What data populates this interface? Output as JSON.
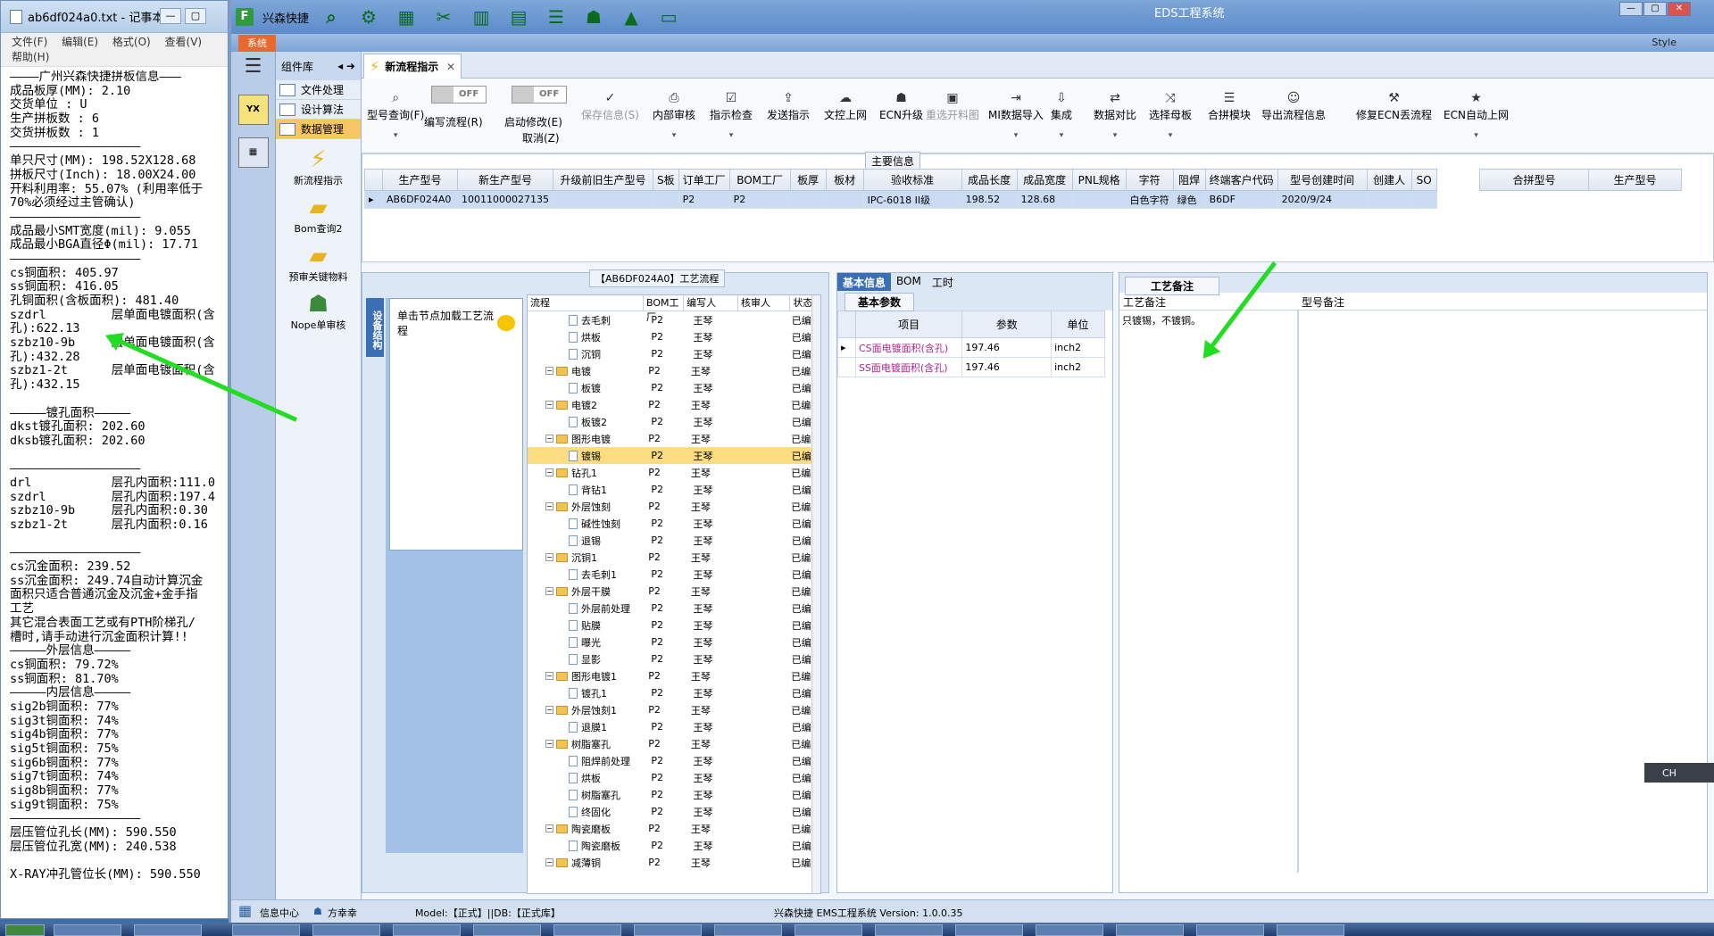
{
  "notepad": {
    "title": "ab6df024a0.txt - 记事本",
    "menu": [
      "文件(F)",
      "编辑(E)",
      "格式(O)",
      "查看(V)",
      "帮助(H)"
    ],
    "lines": [
      "————广州兴森快捷拼板信息———",
      "成品板厚(MM): 2.10",
      "交货单位 : U",
      "生产拼板数 : 6",
      "交货拼板数 : 1",
      "——————————————————",
      "单只尺寸(MM): 198.52X128.68",
      "拼板尺寸(Inch): 18.00X24.00",
      "开料利用率: 55.07% (利用率低于",
      "70%必须经过主管确认)",
      "——————————————————",
      "成品最小SMT宽度(mil): 9.055",
      "成品最小BGA直径Φ(mil): 17.71",
      "——————————————————",
      "cs铜面积: 405.97",
      "ss铜面积: 416.05",
      "孔铜面积(含板面积): 481.40",
      "szdrl         层单面电镀面积(含",
      "孔):622.13",
      "szbz10-9b     层单面电镀面积(含",
      "孔):432.28",
      "szbz1-2t      层单面电镀面积(含",
      "孔):432.15",
      "",
      "—————镀孔面积—————",
      "dkst镀孔面积: 202.60",
      "dksb镀孔面积: 202.60",
      "",
      "——————————————————",
      "drl           层孔内面积:111.0",
      "szdrl         层孔内面积:197.4",
      "szbz10-9b     层孔内面积:0.30",
      "szbz1-2t      层孔内面积:0.16",
      "",
      "——————————————————",
      "cs沉金面积: 239.52",
      "ss沉金面积: 249.74自动计算沉金",
      "面积只适合普通沉金及沉金+金手指",
      "工艺",
      "其它混合表面工艺或有PTH阶梯孔/",
      "槽时,请手动进行沉金面积计算!!",
      "—————外层信息—————",
      "cs铜面积: 79.72%",
      "ss铜面积: 81.70%",
      "—————内层信息—————",
      "sig2b铜面积: 77%",
      "sig3t铜面积: 74%",
      "sig4b铜面积: 77%",
      "sig5t铜面积: 75%",
      "sig6b铜面积: 77%",
      "sig7t铜面积: 74%",
      "sig8b铜面积: 77%",
      "sig9t铜面积: 75%",
      "——————————————————",
      "层压管位孔长(MM): 590.550",
      "层压管位孔宽(MM): 240.538",
      "",
      "X-RAY冲孔管位长(MM): 590.550"
    ]
  },
  "app": {
    "company": "兴森快捷",
    "title": "EDS工程系统",
    "sys_tab": "系统",
    "style_label": "Style",
    "component_lib": "组件库",
    "comp_items": [
      "文件处理",
      "设计算法",
      "数据管理"
    ],
    "comp_big": [
      "新流程指示",
      "Bom查询2",
      "预审关键物料",
      "Nope单审核"
    ],
    "tab_label": "新流程指示",
    "toolbar": {
      "model_query": "型号查询(F)",
      "toggle_off": "OFF",
      "edit_flow": "编写流程(R)",
      "start_modify": "启动修改(E)",
      "cancel": "取消(Z)",
      "save_info": "保存信息(S)",
      "items": [
        "内部审核",
        "指示检查",
        "发送指示",
        "文控上网",
        "ECN升级",
        "重选开料图",
        "MI数据导入",
        "集成",
        "数据对比",
        "选择母板",
        "合拼模块",
        "导出流程信息",
        "修复ECN丢流程",
        "ECN自动上网"
      ]
    },
    "main_info": {
      "title": "主要信息",
      "headers": [
        "生产型号",
        "新生产型号",
        "升级前旧生产型号",
        "S板",
        "订单工厂",
        "BOM工厂",
        "板厚",
        "板材",
        "验收标准",
        "成品长度",
        "成品宽度",
        "PNL规格",
        "字符",
        "阻焊",
        "终端客户代码",
        "型号创建时间",
        "创建人",
        "SO"
      ],
      "row": [
        "AB6DF024A0",
        "10011000027135",
        "",
        "",
        "P2",
        "P2",
        "",
        "",
        "IPC-6018 II级",
        "198.52",
        "128.68",
        "",
        "白色字符",
        "绿色",
        "B6DF",
        "2020/9/24",
        "",
        ""
      ],
      "side_headers": [
        "合拼型号",
        "生产型号"
      ]
    },
    "flow": {
      "title": "【AB6DF024A0】工艺流程",
      "vert_tab": "设备结构",
      "hint": "单击节点加载工艺流程",
      "headers": [
        "流程",
        "BOM工厂",
        "编写人",
        "核审人",
        "状态"
      ],
      "rows": [
        {
          "name": "去毛刺",
          "lvl": 2,
          "bom": "P2",
          "ed": "王琴",
          "st": "已编写"
        },
        {
          "name": "烘板",
          "lvl": 2,
          "bom": "P2",
          "ed": "王琴",
          "st": "已编写"
        },
        {
          "name": "沉铜",
          "lvl": 2,
          "bom": "P2",
          "ed": "王琴",
          "st": "已编写"
        },
        {
          "name": "电镀",
          "lvl": 1,
          "bom": "P2",
          "ed": "王琴",
          "st": "已编写"
        },
        {
          "name": "板镀",
          "lvl": 2,
          "bom": "P2",
          "ed": "王琴",
          "st": "已编写"
        },
        {
          "name": "电镀2",
          "lvl": 1,
          "bom": "P2",
          "ed": "王琴",
          "st": "已编写"
        },
        {
          "name": "板镀2",
          "lvl": 2,
          "bom": "P2",
          "ed": "王琴",
          "st": "已编写"
        },
        {
          "name": "图形电镀",
          "lvl": 1,
          "bom": "P2",
          "ed": "王琴",
          "st": "已编写"
        },
        {
          "name": "镀锡",
          "lvl": 2,
          "bom": "P2",
          "ed": "王琴",
          "st": "已编写",
          "sel": true
        },
        {
          "name": "钻孔1",
          "lvl": 1,
          "bom": "P2",
          "ed": "王琴",
          "st": "已编写"
        },
        {
          "name": "背钻1",
          "lvl": 2,
          "bom": "P2",
          "ed": "王琴",
          "st": "已编写"
        },
        {
          "name": "外层蚀刻",
          "lvl": 1,
          "bom": "P2",
          "ed": "王琴",
          "st": "已编写"
        },
        {
          "name": "碱性蚀刻",
          "lvl": 2,
          "bom": "P2",
          "ed": "王琴",
          "st": "已编写"
        },
        {
          "name": "退锡",
          "lvl": 2,
          "bom": "P2",
          "ed": "王琴",
          "st": "已编写"
        },
        {
          "name": "沉铜1",
          "lvl": 1,
          "bom": "P2",
          "ed": "王琴",
          "st": "已编写"
        },
        {
          "name": "去毛刺1",
          "lvl": 2,
          "bom": "P2",
          "ed": "王琴",
          "st": "已编写"
        },
        {
          "name": "外层干膜",
          "lvl": 1,
          "bom": "P2",
          "ed": "王琴",
          "st": "已编写"
        },
        {
          "name": "外层前处理",
          "lvl": 2,
          "bom": "P2",
          "ed": "王琴",
          "st": "已编写"
        },
        {
          "name": "贴膜",
          "lvl": 2,
          "bom": "P2",
          "ed": "王琴",
          "st": "已编写"
        },
        {
          "name": "曝光",
          "lvl": 2,
          "bom": "P2",
          "ed": "王琴",
          "st": "已编写"
        },
        {
          "name": "显影",
          "lvl": 2,
          "bom": "P2",
          "ed": "王琴",
          "st": "已编写"
        },
        {
          "name": "图形电镀1",
          "lvl": 1,
          "bom": "P2",
          "ed": "王琴",
          "st": "已编写"
        },
        {
          "name": "镀孔1",
          "lvl": 2,
          "bom": "P2",
          "ed": "王琴",
          "st": "已编写"
        },
        {
          "name": "外层蚀刻1",
          "lvl": 1,
          "bom": "P2",
          "ed": "王琴",
          "st": "已编写"
        },
        {
          "name": "退膜1",
          "lvl": 2,
          "bom": "P2",
          "ed": "王琴",
          "st": "已编写"
        },
        {
          "name": "树脂塞孔",
          "lvl": 1,
          "bom": "P2",
          "ed": "王琴",
          "st": "已编写"
        },
        {
          "name": "阻焊前处理",
          "lvl": 2,
          "bom": "P2",
          "ed": "王琴",
          "st": "已编写"
        },
        {
          "name": "烘板",
          "lvl": 2,
          "bom": "P2",
          "ed": "王琴",
          "st": "已编写"
        },
        {
          "name": "树脂塞孔",
          "lvl": 2,
          "bom": "P2",
          "ed": "王琴",
          "st": "已编写"
        },
        {
          "name": "终固化",
          "lvl": 2,
          "bom": "P2",
          "ed": "王琴",
          "st": "已编写"
        },
        {
          "name": "陶瓷磨板",
          "lvl": 1,
          "bom": "P2",
          "ed": "王琴",
          "st": "已编写"
        },
        {
          "name": "陶瓷磨板",
          "lvl": 2,
          "bom": "P2",
          "ed": "王琴",
          "st": "已编写"
        },
        {
          "name": "减薄铜",
          "lvl": 1,
          "bom": "P2",
          "ed": "王琴",
          "st": "已编写"
        }
      ]
    },
    "basic": {
      "tabs": [
        "基本信息",
        "BOM",
        "工时"
      ],
      "sub_tab": "基本参数",
      "headers": [
        "项目",
        "参数",
        "单位"
      ],
      "rows": [
        {
          "item": "CS面电镀面积(含孔)",
          "val": "197.46",
          "unit": "inch2"
        },
        {
          "item": "SS面电镀面积(含孔)",
          "val": "197.46",
          "unit": "inch2"
        }
      ]
    },
    "memo": {
      "tab": "工艺备注",
      "cols": [
        "工艺备注",
        "型号备注"
      ],
      "text": "只镀锡，不镀铜。"
    },
    "status": {
      "info_center": "信息中心",
      "user": "方幸幸",
      "model": "Model:【正式】||DB:【正式库】",
      "version": "兴森快捷 EMS工程系统 Version: 1.0.0.35"
    },
    "ime": "CH"
  }
}
